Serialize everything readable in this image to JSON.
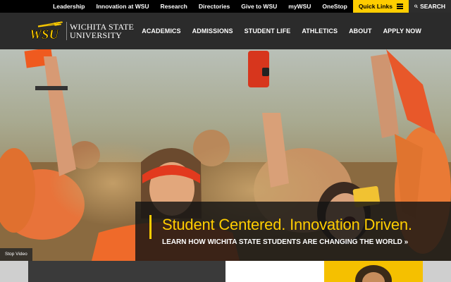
{
  "utility": {
    "links": [
      "Leadership",
      "Innovation at WSU",
      "Research",
      "Directories",
      "Give to WSU",
      "myWSU",
      "OneStop"
    ],
    "quick_links": "Quick Links",
    "search": "SEARCH"
  },
  "brand": {
    "mark": "WSU",
    "name_line1": "WICHITA STATE",
    "name_line2": "UNIVERSITY"
  },
  "nav": {
    "items": [
      "ACADEMICS",
      "ADMISSIONS",
      "STUDENT LIFE",
      "ATHLETICS",
      "ABOUT",
      "APPLY NOW"
    ]
  },
  "hero": {
    "headline": "Student Centered. Innovation Driven.",
    "subhead": "LEARN HOW WICHITA STATE STUDENTS ARE CHANGING THE WORLD »",
    "stop_video": "Stop Video"
  },
  "colors": {
    "gold": "#ffcd00",
    "black": "#000000",
    "charcoal": "#2b2b2b"
  }
}
